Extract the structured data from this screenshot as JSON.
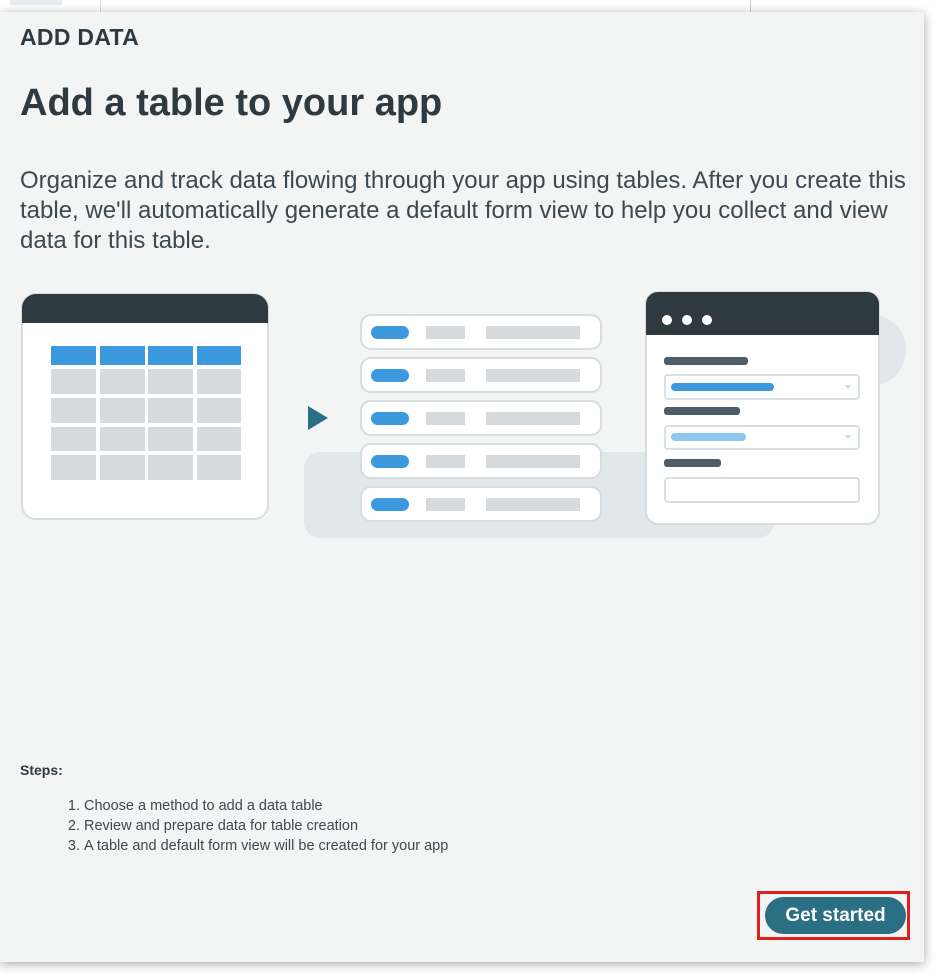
{
  "dialog": {
    "eyebrow": "ADD DATA",
    "title": "Add a table to your app",
    "description": "Organize and track data flowing through your app using tables. After you create this table, we'll automatically generate a default form view to help you collect and view data for this table.",
    "steps_label": "Steps:",
    "steps": [
      "Choose a method to add a data table",
      "Review and prepare data for table creation",
      "A table and default form view will be created for your app"
    ],
    "primary_button": "Get started"
  },
  "colors": {
    "panel_bg": "#f3f4f4",
    "text_dark": "#2e3a42",
    "accent_blue": "#3d99dd",
    "button_teal": "#2b6f84",
    "highlight_red": "#e02020"
  },
  "icons": [
    "table-illustration",
    "play-arrow-icon",
    "record-list-illustration",
    "form-view-illustration",
    "dropdown-caret-icon"
  ]
}
